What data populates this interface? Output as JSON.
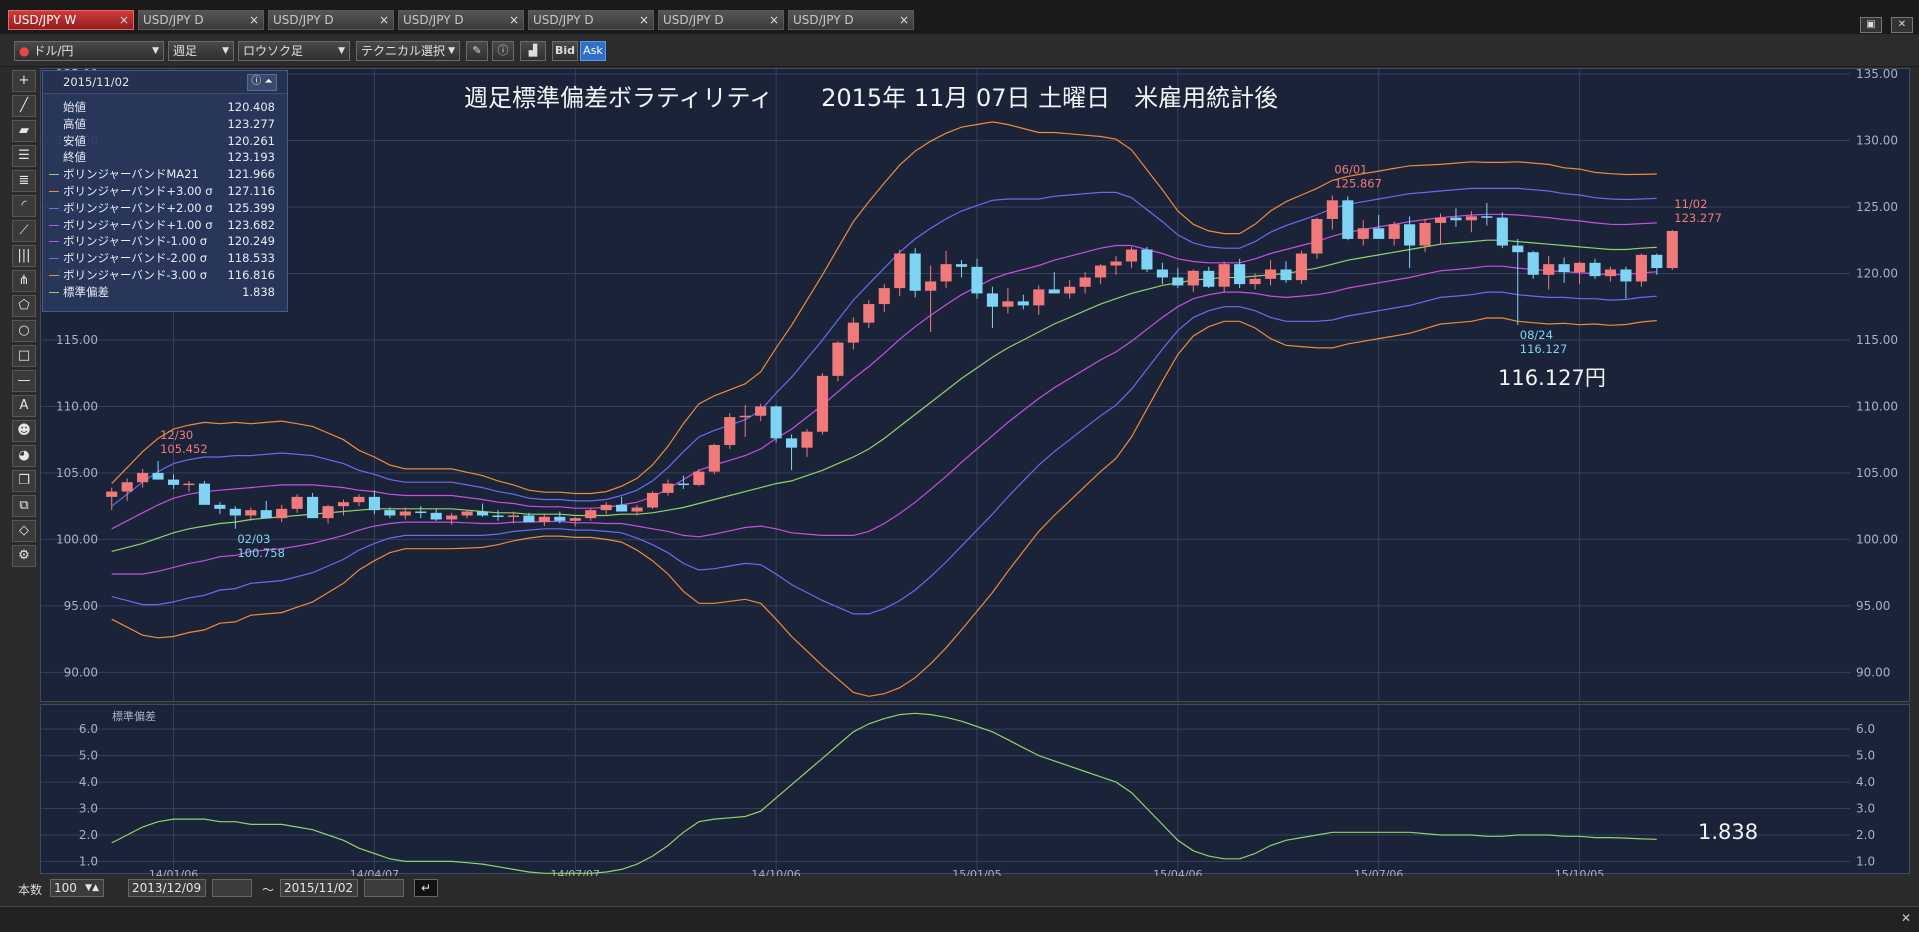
{
  "tabs": [
    {
      "label": "USD/JPY W",
      "active": true
    },
    {
      "label": "USD/JPY D",
      "active": false
    },
    {
      "label": "USD/JPY D",
      "active": false
    },
    {
      "label": "USD/JPY D",
      "active": false
    },
    {
      "label": "USD/JPY D",
      "active": false
    },
    {
      "label": "USD/JPY D",
      "active": false
    },
    {
      "label": "USD/JPY D",
      "active": false
    }
  ],
  "tab_close_glyph": "×",
  "toolbar": {
    "pair": "ドル/円",
    "period": "週足",
    "chart_type": "ロウソク足",
    "technical": "テクニカル選択",
    "bid": "Bid",
    "ask": "Ask"
  },
  "info": {
    "date": "2015/11/02",
    "rows": [
      {
        "label": "始値",
        "value": "120.408",
        "color": ""
      },
      {
        "label": "高値",
        "value": "123.277",
        "color": ""
      },
      {
        "label": "安値",
        "value": "120.261",
        "color": ""
      },
      {
        "label": "終値",
        "value": "123.193",
        "color": ""
      },
      {
        "label": "ボリンジャーバンドMA21",
        "value": "121.966",
        "color": "#8fd46a"
      },
      {
        "label": "ボリンジャーバンド+3.00 σ",
        "value": "127.116",
        "color": "#f08a3a"
      },
      {
        "label": "ボリンジャーバンド+2.00 σ",
        "value": "125.399",
        "color": "#6a6cf0"
      },
      {
        "label": "ボリンジャーバンド+1.00 σ",
        "value": "123.682",
        "color": "#c650e0"
      },
      {
        "label": "ボリンジャーバンド-1.00 σ",
        "value": "120.249",
        "color": "#c650e0"
      },
      {
        "label": "ボリンジャーバンド-2.00 σ",
        "value": "118.533",
        "color": "#6a6cf0"
      },
      {
        "label": "ボリンジャーバンド-3.00 σ",
        "value": "116.816",
        "color": "#f08a3a"
      },
      {
        "label": "標準偏差",
        "value": "1.838",
        "color": "#8fd46a"
      }
    ]
  },
  "headline": "週足標準偏差ボラティリティ　　2015年 11月 07日 土曜日　米雇用統計後",
  "big_price": "116.127円",
  "big_sd": "1.838",
  "sub_label": "標準偏差",
  "bottom": {
    "count_label": "本数",
    "count": "100",
    "from": "2013/12/09",
    "tilde": "～",
    "to": "2015/11/02"
  },
  "colors": {
    "bull": "#f07a7a",
    "bear": "#7fd4f4",
    "ma": "#8fd46a",
    "sd1": "#c650e0",
    "sd2": "#6a6cf0",
    "sd3": "#f08a3a",
    "grid": "#35415c",
    "axis_text": "#a7b1c6",
    "hi_label": "#f07a7a",
    "lo_label": "#7fd4f4"
  },
  "chart_data": [
    {
      "type": "candlestick",
      "ylim": [
        88,
        135
      ],
      "yticks": [
        "90.00",
        "95.00",
        "100.00",
        "105.00",
        "110.00",
        "115.00",
        "120.00",
        "125.00",
        "130.00",
        "135.00"
      ],
      "ytick_values": [
        90,
        95,
        100,
        105,
        110,
        115,
        120,
        125,
        130,
        135
      ],
      "xticks": [
        "14/01/06",
        "14/04/07",
        "14/07/07",
        "14/10/06",
        "15/01/05",
        "15/04/06",
        "15/07/06",
        "15/10/05"
      ],
      "xtick_index": [
        4,
        17,
        30,
        43,
        56,
        69,
        82,
        95
      ],
      "candles": [
        [
          103.2,
          103.9,
          102.2,
          103.6
        ],
        [
          103.6,
          104.6,
          102.9,
          104.3
        ],
        [
          104.3,
          105.3,
          103.9,
          105.0
        ],
        [
          105.0,
          105.9,
          104.5,
          104.5
        ],
        [
          104.5,
          104.9,
          103.8,
          104.1
        ],
        [
          104.1,
          104.4,
          103.6,
          104.2
        ],
        [
          104.2,
          104.4,
          102.9,
          102.6
        ],
        [
          102.6,
          102.8,
          101.9,
          102.3
        ],
        [
          102.3,
          102.5,
          100.8,
          101.8
        ],
        [
          101.8,
          102.4,
          101.4,
          102.2
        ],
        [
          102.2,
          102.9,
          101.6,
          101.6
        ],
        [
          101.6,
          102.6,
          101.3,
          102.3
        ],
        [
          102.3,
          103.4,
          102.0,
          103.2
        ],
        [
          103.2,
          103.5,
          101.8,
          101.6
        ],
        [
          101.6,
          102.6,
          101.2,
          102.5
        ],
        [
          102.5,
          103.0,
          101.8,
          102.8
        ],
        [
          102.8,
          103.4,
          102.5,
          103.2
        ],
        [
          103.2,
          103.7,
          101.9,
          102.2
        ],
        [
          102.2,
          102.4,
          101.6,
          101.8
        ],
        [
          101.8,
          102.4,
          101.5,
          102.1
        ],
        [
          102.1,
          102.5,
          101.6,
          102.0
        ],
        [
          102.0,
          102.3,
          101.4,
          101.5
        ],
        [
          101.5,
          102.0,
          101.1,
          101.8
        ],
        [
          101.8,
          102.2,
          101.6,
          102.1
        ],
        [
          102.1,
          102.7,
          101.7,
          101.8
        ],
        [
          101.8,
          102.2,
          101.4,
          101.7
        ],
        [
          101.7,
          102.1,
          101.2,
          101.8
        ],
        [
          101.8,
          102.0,
          101.4,
          101.3
        ],
        [
          101.3,
          101.9,
          101.0,
          101.7
        ],
        [
          101.7,
          102.1,
          101.2,
          101.4
        ],
        [
          101.4,
          101.7,
          101.0,
          101.6
        ],
        [
          101.6,
          102.3,
          101.4,
          102.2
        ],
        [
          102.2,
          102.8,
          101.9,
          102.6
        ],
        [
          102.6,
          103.2,
          102.3,
          102.1
        ],
        [
          102.1,
          102.6,
          101.8,
          102.4
        ],
        [
          102.4,
          103.6,
          102.3,
          103.5
        ],
        [
          103.5,
          104.5,
          103.3,
          104.2
        ],
        [
          104.2,
          104.8,
          103.8,
          104.1
        ],
        [
          104.1,
          105.3,
          104.0,
          105.1
        ],
        [
          105.1,
          107.2,
          104.9,
          107.1
        ],
        [
          107.1,
          109.5,
          106.8,
          109.2
        ],
        [
          109.2,
          110.1,
          107.7,
          109.3
        ],
        [
          109.3,
          110.2,
          108.9,
          110.0
        ],
        [
          110.0,
          110.1,
          107.3,
          107.6
        ],
        [
          107.6,
          107.9,
          105.2,
          106.9
        ],
        [
          106.9,
          108.3,
          106.2,
          108.1
        ],
        [
          108.1,
          112.5,
          107.9,
          112.3
        ],
        [
          112.3,
          114.9,
          111.9,
          114.8
        ],
        [
          114.8,
          116.7,
          114.3,
          116.3
        ],
        [
          116.3,
          118.0,
          115.9,
          117.7
        ],
        [
          117.7,
          119.2,
          117.1,
          118.9
        ],
        [
          118.9,
          121.8,
          118.3,
          121.5
        ],
        [
          121.5,
          121.9,
          118.2,
          118.7
        ],
        [
          118.7,
          120.6,
          115.6,
          119.4
        ],
        [
          119.4,
          121.7,
          118.9,
          120.7
        ],
        [
          120.7,
          121.0,
          119.7,
          120.5
        ],
        [
          120.5,
          121.1,
          118.1,
          118.5
        ],
        [
          118.5,
          119.0,
          115.9,
          117.5
        ],
        [
          117.5,
          118.9,
          117.0,
          117.9
        ],
        [
          117.9,
          118.4,
          117.3,
          117.6
        ],
        [
          117.6,
          119.1,
          116.9,
          118.8
        ],
        [
          118.8,
          120.1,
          118.5,
          118.5
        ],
        [
          118.5,
          119.5,
          118.1,
          119.0
        ],
        [
          119.0,
          120.1,
          118.5,
          119.7
        ],
        [
          119.7,
          120.7,
          119.2,
          120.6
        ],
        [
          120.6,
          121.3,
          119.9,
          120.9
        ],
        [
          120.9,
          122.0,
          120.4,
          121.8
        ],
        [
          121.8,
          122.0,
          120.1,
          120.3
        ],
        [
          120.3,
          120.8,
          119.2,
          119.7
        ],
        [
          119.7,
          120.4,
          118.9,
          119.1
        ],
        [
          119.1,
          120.3,
          118.6,
          120.2
        ],
        [
          120.2,
          120.5,
          118.9,
          119.0
        ],
        [
          119.0,
          120.9,
          118.6,
          120.7
        ],
        [
          120.7,
          121.1,
          118.9,
          119.2
        ],
        [
          119.2,
          120.0,
          118.8,
          119.6
        ],
        [
          119.6,
          121.0,
          119.1,
          120.3
        ],
        [
          120.3,
          120.9,
          119.3,
          119.5
        ],
        [
          119.5,
          121.7,
          119.2,
          121.5
        ],
        [
          121.5,
          124.2,
          121.1,
          124.1
        ],
        [
          124.1,
          125.87,
          123.3,
          125.5
        ],
        [
          125.5,
          125.8,
          122.5,
          122.6
        ],
        [
          122.6,
          124.0,
          122.1,
          123.4
        ],
        [
          123.4,
          124.4,
          122.6,
          122.6
        ],
        [
          122.6,
          123.9,
          122.1,
          123.7
        ],
        [
          123.7,
          124.3,
          120.4,
          122.1
        ],
        [
          122.1,
          124.1,
          121.6,
          123.8
        ],
        [
          123.8,
          124.5,
          122.2,
          124.2
        ],
        [
          124.2,
          124.9,
          123.5,
          124.0
        ],
        [
          124.0,
          124.7,
          123.1,
          124.3
        ],
        [
          124.3,
          125.3,
          123.6,
          124.2
        ],
        [
          124.2,
          124.6,
          121.9,
          122.1
        ],
        [
          122.1,
          122.6,
          116.127,
          121.6
        ],
        [
          121.6,
          121.7,
          119.6,
          119.9
        ],
        [
          119.9,
          121.3,
          118.8,
          120.7
        ],
        [
          120.7,
          121.2,
          119.3,
          120.1
        ],
        [
          120.1,
          120.9,
          119.2,
          120.8
        ],
        [
          120.8,
          121.1,
          119.6,
          119.8
        ],
        [
          119.8,
          120.5,
          119.4,
          120.3
        ],
        [
          120.3,
          120.5,
          118.1,
          119.4
        ],
        [
          119.4,
          121.5,
          119.0,
          121.4
        ],
        [
          121.4,
          121.5,
          119.9,
          120.408
        ],
        [
          120.408,
          123.277,
          120.261,
          123.193
        ]
      ],
      "ma21": [
        99.1,
        99.4,
        99.7,
        100.1,
        100.5,
        100.8,
        101.0,
        101.2,
        101.3,
        101.5,
        101.6,
        101.7,
        101.8,
        101.9,
        102.0,
        102.1,
        102.2,
        102.3,
        102.3,
        102.3,
        102.3,
        102.3,
        102.3,
        102.2,
        102.1,
        102.0,
        102.0,
        101.9,
        101.9,
        101.9,
        101.8,
        101.8,
        101.8,
        101.9,
        101.9,
        102.0,
        102.2,
        102.4,
        102.7,
        103.0,
        103.3,
        103.6,
        103.9,
        104.2,
        104.4,
        104.8,
        105.2,
        105.7,
        106.2,
        106.8,
        107.6,
        108.5,
        109.4,
        110.3,
        111.2,
        112.1,
        112.9,
        113.7,
        114.4,
        115.0,
        115.6,
        116.2,
        116.7,
        117.2,
        117.7,
        118.1,
        118.5,
        118.8,
        119.1,
        119.3,
        119.5,
        119.6,
        119.7,
        119.7,
        119.8,
        119.9,
        120.0,
        120.2,
        120.4,
        120.7,
        121.0,
        121.2,
        121.4,
        121.6,
        121.8,
        122.0,
        122.2,
        122.3,
        122.4,
        122.5,
        122.5,
        122.4,
        122.3,
        122.2,
        122.1,
        122.0,
        121.9,
        121.8,
        121.8,
        121.9,
        121.966
      ],
      "sd": [
        1.7,
        2.0,
        2.3,
        2.5,
        2.6,
        2.6,
        2.6,
        2.5,
        2.5,
        2.4,
        2.4,
        2.4,
        2.3,
        2.2,
        2.0,
        1.8,
        1.5,
        1.3,
        1.1,
        1.0,
        1.0,
        1.0,
        1.0,
        0.95,
        0.9,
        0.8,
        0.7,
        0.6,
        0.55,
        0.55,
        0.55,
        0.55,
        0.6,
        0.7,
        0.9,
        1.2,
        1.6,
        2.1,
        2.5,
        2.6,
        2.65,
        2.7,
        2.9,
        3.4,
        3.9,
        4.4,
        4.9,
        5.4,
        5.9,
        6.2,
        6.4,
        6.55,
        6.6,
        6.55,
        6.45,
        6.3,
        6.1,
        5.9,
        5.6,
        5.3,
        5.0,
        4.8,
        4.6,
        4.4,
        4.2,
        4.0,
        3.6,
        3.0,
        2.4,
        1.8,
        1.4,
        1.2,
        1.1,
        1.1,
        1.3,
        1.6,
        1.8,
        1.9,
        2.0,
        2.1,
        2.1,
        2.1,
        2.1,
        2.1,
        2.1,
        2.05,
        2.0,
        2.0,
        2.0,
        1.95,
        1.95,
        2.0,
        2.0,
        2.0,
        1.95,
        1.95,
        1.9,
        1.9,
        1.88,
        1.85,
        1.838
      ],
      "annotations": [
        {
          "idx": 3,
          "date": "12/30",
          "price": "105.452",
          "kind": "high"
        },
        {
          "idx": 8,
          "date": "02/03",
          "price": "100.758",
          "kind": "low"
        },
        {
          "idx": 79,
          "date": "06/01",
          "price": "125.867",
          "kind": "high"
        },
        {
          "idx": 91,
          "date": "08/24",
          "price": "116.127",
          "kind": "low"
        },
        {
          "idx": 101,
          "date": "11/02",
          "price": "123.277",
          "kind": "high"
        }
      ]
    },
    {
      "type": "line",
      "title": "標準偏差",
      "ylim": [
        0.6,
        6.8
      ],
      "yticks": [
        "1.0",
        "2.0",
        "3.0",
        "4.0",
        "5.0",
        "6.0"
      ],
      "ytick_values": [
        1,
        2,
        3,
        4,
        5,
        6
      ]
    }
  ]
}
